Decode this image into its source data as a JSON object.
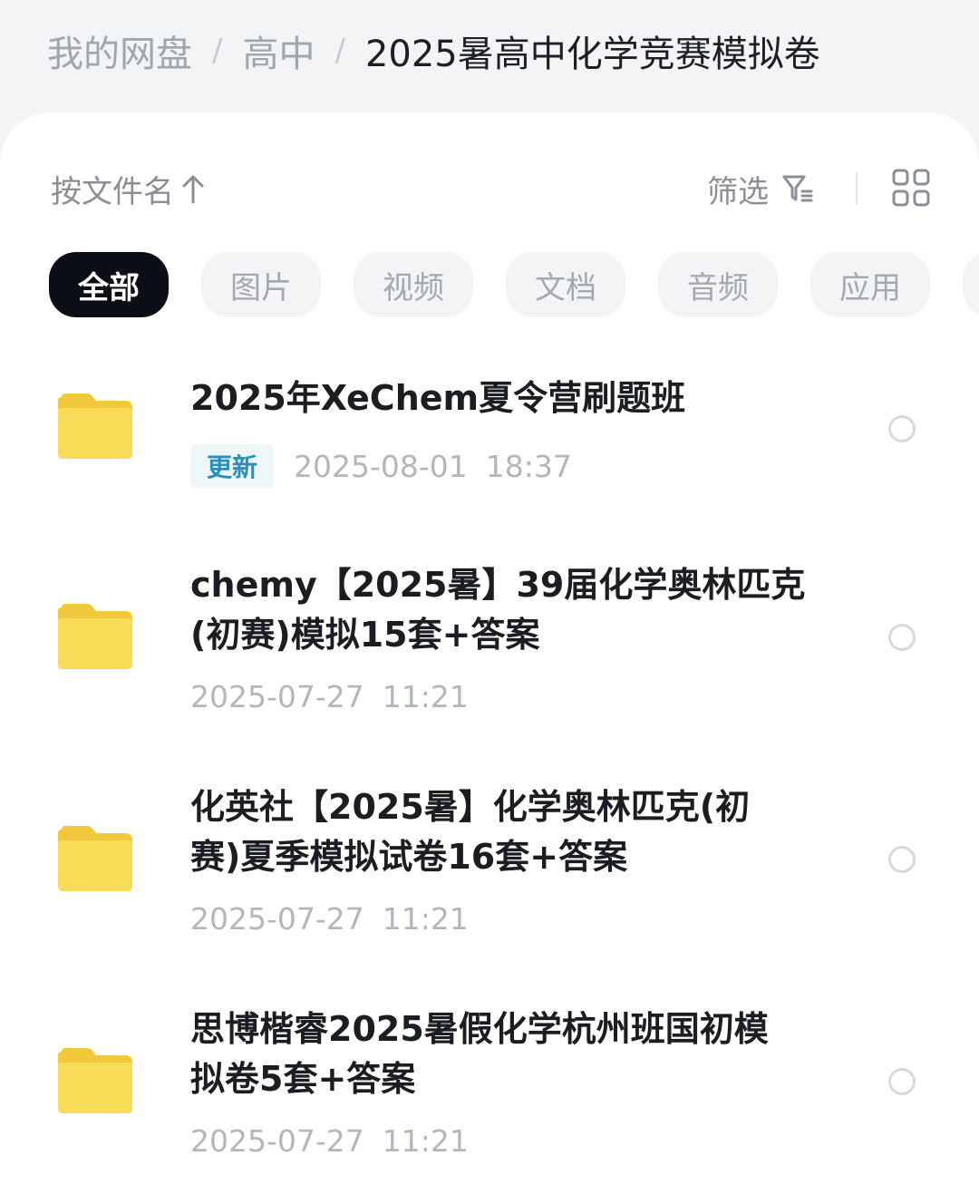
{
  "breadcrumb": {
    "items": [
      "我的网盘",
      "高中"
    ],
    "separator": "/",
    "current": "2025暑高中化学竞赛模拟卷"
  },
  "toolbar": {
    "sort_label": "按文件名",
    "sort_icon": "arrow-up-icon",
    "filter_label": "筛选",
    "filter_icon": "filter-icon",
    "view_toggle_icon": "grid-view-icon"
  },
  "tabs": [
    {
      "label": "全部",
      "active": true
    },
    {
      "label": "图片",
      "active": false
    },
    {
      "label": "视频",
      "active": false
    },
    {
      "label": "文档",
      "active": false
    },
    {
      "label": "音频",
      "active": false
    },
    {
      "label": "应用",
      "active": false
    }
  ],
  "files": [
    {
      "name_lines": [
        "2025年XeChem夏令营刷题班"
      ],
      "badge": "更新",
      "date": "2025-08-01",
      "time": "18:37",
      "icon": "folder-icon"
    },
    {
      "name_lines": [
        "chemy【2025暑】39届化学奥林匹克",
        "(初赛)模拟15套+答案"
      ],
      "badge": "",
      "date": "2025-07-27",
      "time": "11:21",
      "icon": "folder-icon"
    },
    {
      "name_lines": [
        "化英社【2025暑】化学奥林匹克(初",
        "赛)夏季模拟试卷16套+答案"
      ],
      "badge": "",
      "date": "2025-07-27",
      "time": "11:21",
      "icon": "folder-icon"
    },
    {
      "name_lines": [
        "思博楷睿2025暑假化学杭州班国初模",
        "拟卷5套+答案"
      ],
      "badge": "",
      "date": "2025-07-27",
      "time": "11:21",
      "icon": "folder-icon"
    }
  ],
  "colors": {
    "background": "#f3f4f6",
    "card": "#ffffff",
    "active_tab": "#0b0e14",
    "folder": "#f7d94c",
    "badge_text": "#2a8fb8",
    "badge_bg": "#eef6fa"
  }
}
